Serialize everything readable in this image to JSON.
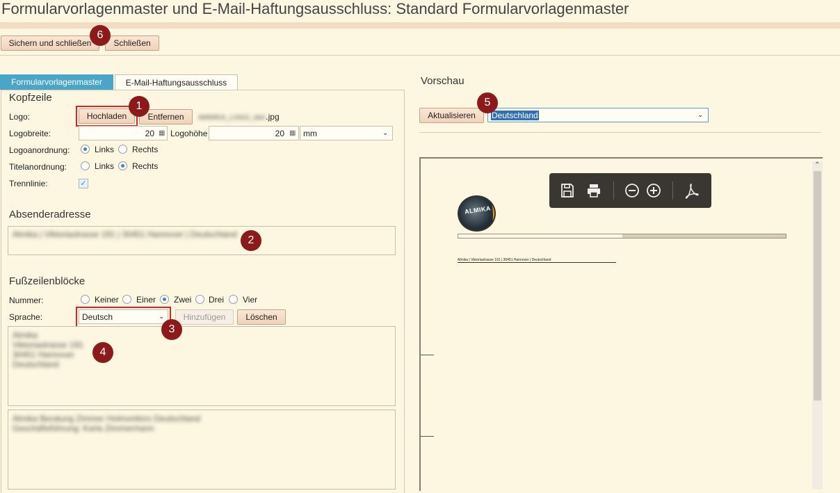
{
  "page_title": "Formularvorlagenmaster und E-Mail-Haftungsausschluss: Standard Formularvorlagenmaster",
  "toolbar": {
    "save_close": "Sichern und schließen",
    "close": "Schließen"
  },
  "tabs": [
    {
      "label": "Formularvorlagenmaster",
      "active": true
    },
    {
      "label": "E-Mail-Haftungsausschluss",
      "active": false
    }
  ],
  "kopfzeile": {
    "title": "Kopfzeile",
    "logo_label": "Logo:",
    "upload": "Hochladen",
    "remove": "Entfernen",
    "file_suffix": ".jpg",
    "width_label": "Logobreite:",
    "width_value": "20",
    "height_label": "Logohöhe",
    "height_value": "20",
    "unit": "mm",
    "logo_align_label": "Logoanordnung:",
    "title_align_label": "Titelanordnung:",
    "left": "Links",
    "right": "Rechts",
    "logo_align": "Links",
    "title_align": "Rechts",
    "divider_label": "Trennlinie:",
    "divider_checked": true
  },
  "absender": {
    "title": "Absenderadresse",
    "value": "Almika | Viktoriastrasse 191 | 30451 Hannover | Deutschland"
  },
  "fusszeilen": {
    "title": "Fußzeilenblöcke",
    "number_label": "Nummer:",
    "options": [
      "Keiner",
      "Einer",
      "Zwei",
      "Drei",
      "Vier"
    ],
    "selected": "Zwei",
    "language_label": "Sprache:",
    "language": "Deutsch",
    "add": "Hinzufügen",
    "delete": "Löschen",
    "block1": "Almika\nViktoriastrasse 191\n30451 Hannover\nDeutschland",
    "block2": "Almika Beratung Zimmer Hotmonitors Deutschland\nGeschäftsführung: Karla Zimmermann"
  },
  "preview": {
    "title": "Vorschau",
    "refresh": "Aktualisieren",
    "country": "Deutschland",
    "sender_line": "Almika | Viktoriastrasse 191 | 30451 Hannover | Deutschland",
    "logo_text": "ALMIKA"
  },
  "badges": [
    "1",
    "2",
    "3",
    "4",
    "5",
    "6"
  ],
  "colors": {
    "tab_active": "#4aa6c8",
    "badge": "#8c1a1a",
    "highlight": "#e0212a",
    "selected_text_bg": "#2f6fb5"
  },
  "icons": [
    "save-icon",
    "print-icon",
    "zoom-out-icon",
    "zoom-in-icon",
    "pdf-icon",
    "calendar-icon",
    "chevron-down-icon",
    "scroll-up-icon"
  ]
}
